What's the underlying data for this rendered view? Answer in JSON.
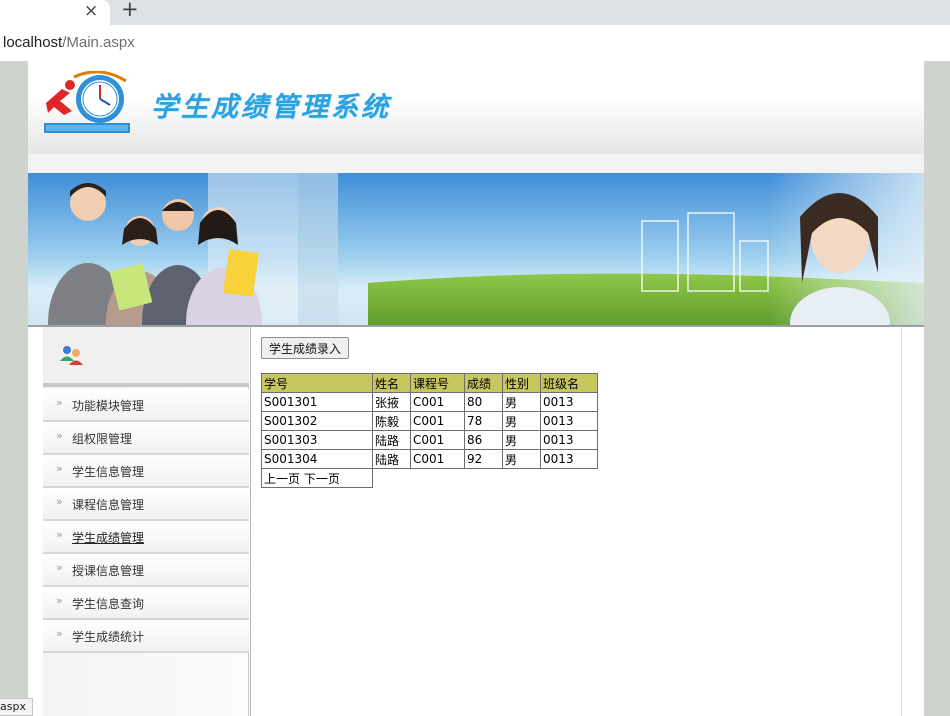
{
  "browser": {
    "tab_close": "×",
    "new_tab": "+",
    "url_host": "localhost",
    "url_path": "/Main.aspx",
    "status_text": "aspx"
  },
  "header": {
    "title": "学生成绩管理系统",
    "logo_alt": "GRADE SYSTEM"
  },
  "sidebar": {
    "items": [
      {
        "label": "功能模块管理"
      },
      {
        "label": "组权限管理"
      },
      {
        "label": "学生信息管理"
      },
      {
        "label": "课程信息管理"
      },
      {
        "label": "学生成绩管理"
      },
      {
        "label": "授课信息管理"
      },
      {
        "label": "学生信息查询"
      },
      {
        "label": "学生成绩统计"
      }
    ],
    "arrow": "»"
  },
  "main": {
    "entry_button": "学生成绩录入",
    "columns": [
      "学号",
      "姓名",
      "课程号",
      "成绩",
      "性别",
      "班级名"
    ],
    "rows": [
      [
        "S001301",
        "张掖",
        "C001",
        "80",
        "男",
        "0013"
      ],
      [
        "S001302",
        "陈毅",
        "C001",
        "78",
        "男",
        "0013"
      ],
      [
        "S001303",
        "陆路",
        "C001",
        "86",
        "男",
        "0013"
      ],
      [
        "S001304",
        "陆路",
        "C001",
        "92",
        "男",
        "0013"
      ]
    ],
    "pager": "上一页 下一页"
  },
  "colors": {
    "header_accent": "#2aa1e0",
    "table_header_bg": "#c7c760"
  }
}
